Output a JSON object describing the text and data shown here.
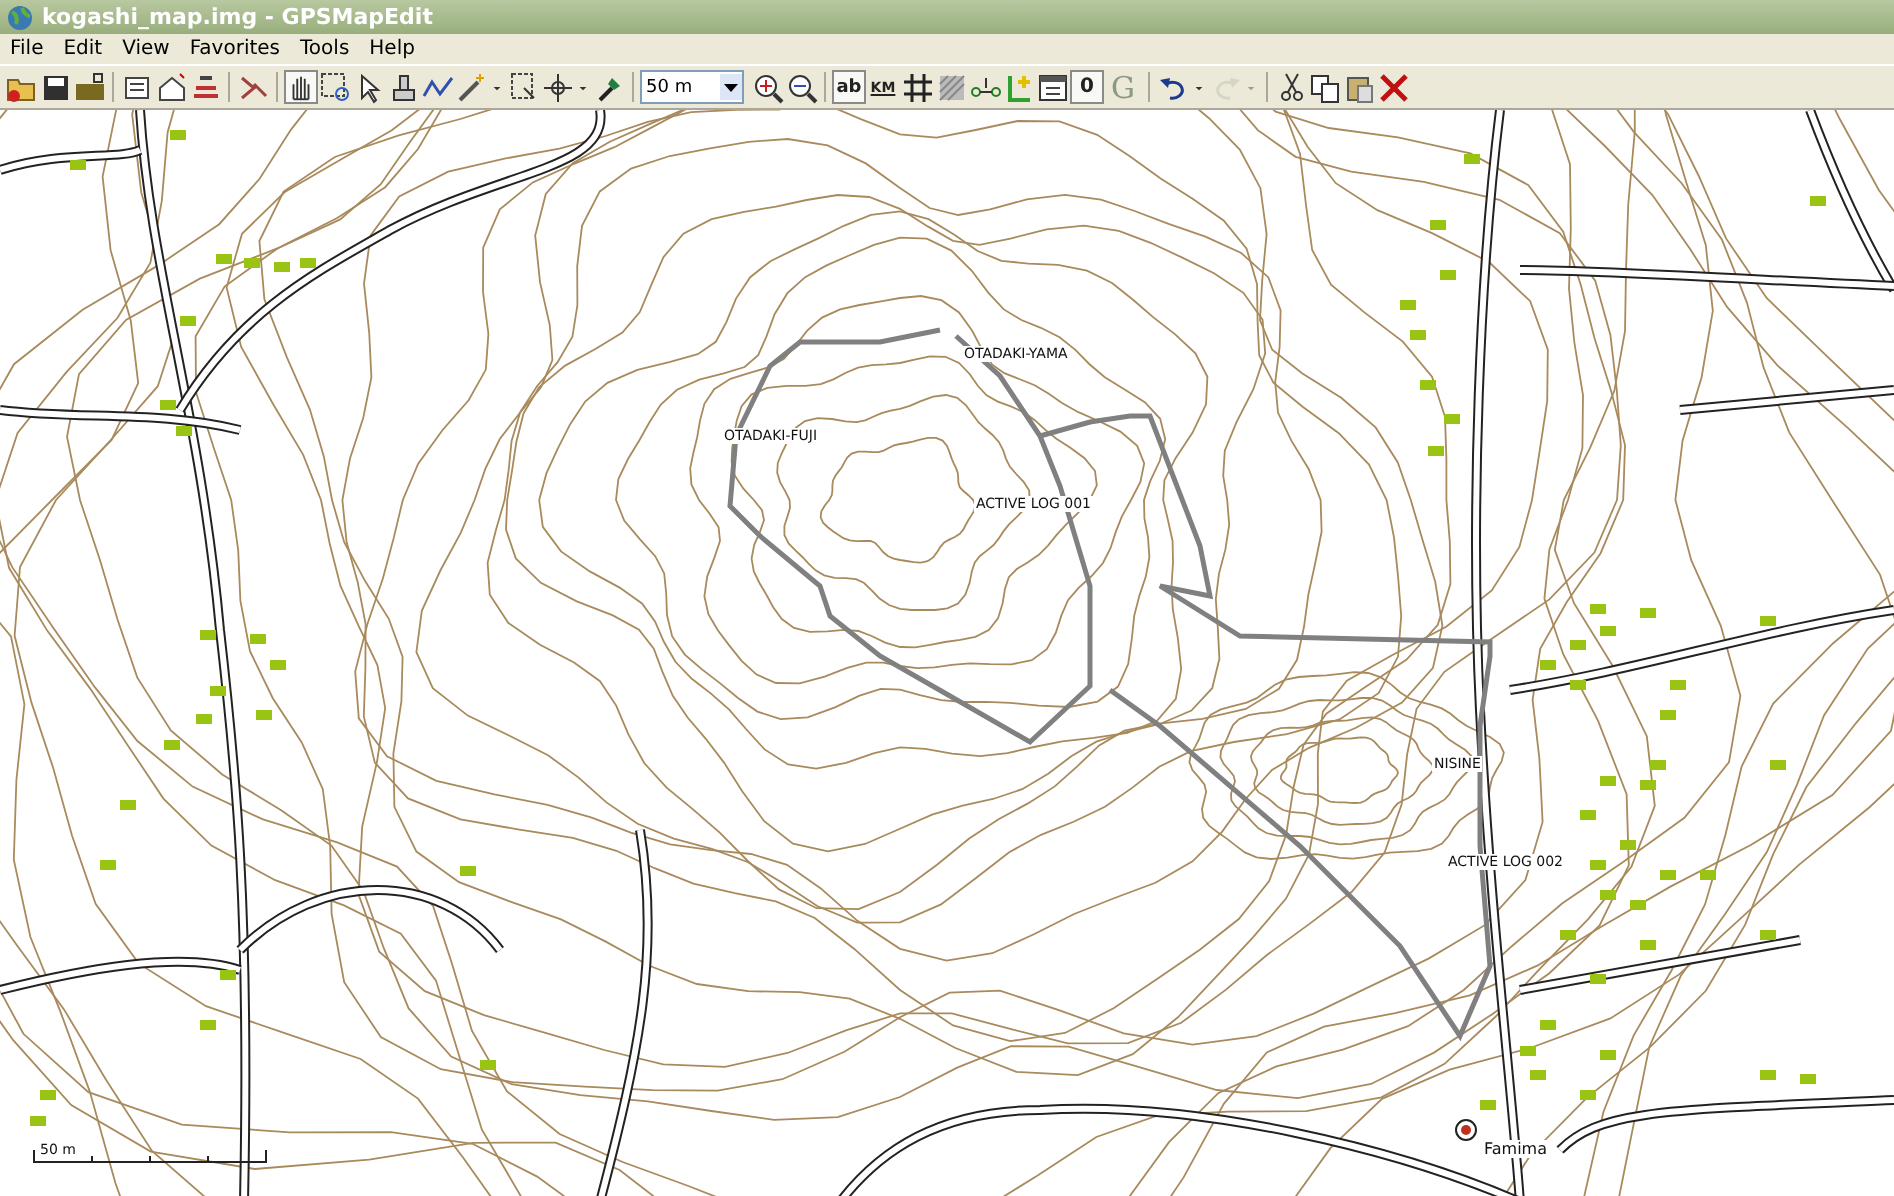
{
  "window": {
    "title": "kogashi_map.img - GPSMapEdit"
  },
  "menu": [
    "File",
    "Edit",
    "View",
    "Favorites",
    "Tools",
    "Help"
  ],
  "toolbar": {
    "tool_buttons": [
      {
        "selected": true
      },
      {
        "selected": false
      },
      {
        "selected": false
      }
    ],
    "scale_select": {
      "value": "50 m"
    },
    "text_buttons": [
      {
        "label": "ab",
        "selected": true
      },
      {
        "label": "KM",
        "selected": false
      },
      {
        "label": "0",
        "selected": true
      },
      {
        "label": "G",
        "selected": false
      }
    ],
    "redo_disabled": true
  },
  "map": {
    "labels": [
      {
        "kind": "peak",
        "text": "OTADAKI-YAMA"
      },
      {
        "kind": "peak",
        "text": "OTADAKI-FUJI"
      },
      {
        "kind": "track",
        "text": "ACTIVE LOG 001"
      },
      {
        "kind": "place",
        "text": "NISINE"
      },
      {
        "kind": "track",
        "text": "ACTIVE LOG 002"
      },
      {
        "kind": "poi",
        "text": "Famima"
      }
    ],
    "scale_bar": "50 m"
  }
}
